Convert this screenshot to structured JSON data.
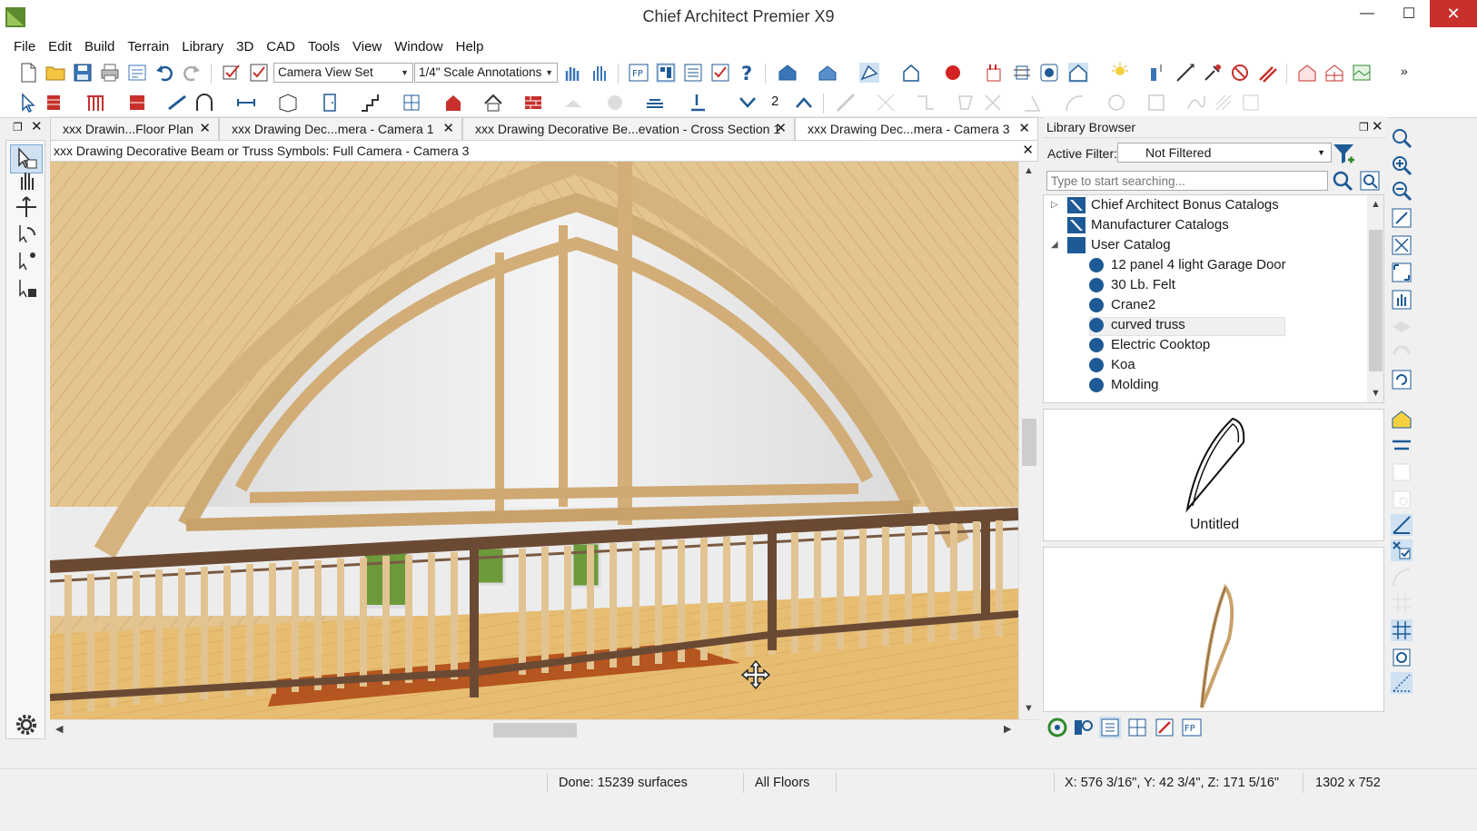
{
  "window": {
    "title": "Chief Architect Premier X9",
    "minimize_glyph": "—",
    "maximize_glyph": "☐",
    "close_glyph": "✕"
  },
  "menu": [
    "File",
    "Edit",
    "Build",
    "Terrain",
    "Library",
    "3D",
    "CAD",
    "Tools",
    "View",
    "Window",
    "Help"
  ],
  "toolbar": {
    "layer_set": "Camera View Set",
    "annotation_set": "1/4\" Scale Annotations",
    "floor_number": "2"
  },
  "tabs": [
    {
      "label": "xxx Drawin...Floor Plan",
      "active": false
    },
    {
      "label": "xxx Drawing Dec...mera - Camera 1",
      "active": false
    },
    {
      "label": "xxx Drawing Decorative Be...evation - Cross Section 1",
      "active": false
    },
    {
      "label": "xxx Drawing Dec...mera - Camera 3",
      "active": true
    }
  ],
  "view": {
    "header": "xxx Drawing Decorative Beam or Truss Symbols: Full Camera - Camera 3"
  },
  "library": {
    "title": "Library Browser",
    "filter_label": "Active Filter:",
    "filter_value": "Not Filtered",
    "search_placeholder": "Type to start searching...",
    "tree": [
      {
        "label": "Chief Architect Bonus Catalogs",
        "level": 0,
        "type": "catalog",
        "expander": "▷"
      },
      {
        "label": "Manufacturer Catalogs",
        "level": 0,
        "type": "catalog",
        "expander": ""
      },
      {
        "label": "User Catalog",
        "level": 0,
        "type": "folder",
        "expander": "◢"
      },
      {
        "label": "12 panel 4 light Garage Door",
        "level": 1,
        "type": "item"
      },
      {
        "label": "30 Lb. Felt",
        "level": 1,
        "type": "item"
      },
      {
        "label": "Crane2",
        "level": 1,
        "type": "item"
      },
      {
        "label": "curved truss",
        "level": 1,
        "type": "item",
        "selected": true
      },
      {
        "label": "Electric Cooktop",
        "level": 1,
        "type": "item"
      },
      {
        "label": "Koa",
        "level": 1,
        "type": "item"
      },
      {
        "label": "Molding",
        "level": 1,
        "type": "item"
      }
    ],
    "preview_label": "Untitled"
  },
  "status": {
    "done": "Done:  15239 surfaces",
    "floors": "All Floors",
    "coords": "X: 576 3/16\", Y: 42 3/4\", Z: 171 5/16\"",
    "size": "1302 x 752"
  },
  "colors": {
    "accent_blue": "#1e5a96",
    "close_red": "#c7302b",
    "wood_light": "#e8c99a",
    "wood_dark": "#6b4a34"
  }
}
